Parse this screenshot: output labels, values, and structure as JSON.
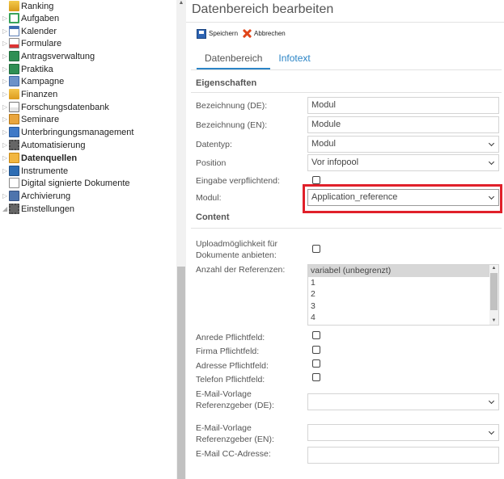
{
  "sidebar": {
    "items": [
      {
        "label": "Ranking",
        "icon": "trophy-icon",
        "expander": ""
      },
      {
        "label": "Aufgaben",
        "icon": "tasks-icon",
        "expander": "▷"
      },
      {
        "label": "Kalender",
        "icon": "calendar-icon",
        "expander": "▷"
      },
      {
        "label": "Formulare",
        "icon": "form-icon",
        "expander": "▷"
      },
      {
        "label": "Antragsverwaltung",
        "icon": "application-icon",
        "expander": "▷"
      },
      {
        "label": "Praktika",
        "icon": "internship-icon",
        "expander": "▷"
      },
      {
        "label": "Kampagne",
        "icon": "campaign-icon",
        "expander": "▷"
      },
      {
        "label": "Finanzen",
        "icon": "finance-icon",
        "expander": "▷"
      },
      {
        "label": "Forschungsdatenbank",
        "icon": "chart-icon",
        "expander": "▷"
      },
      {
        "label": "Seminare",
        "icon": "seminar-icon",
        "expander": "▷"
      },
      {
        "label": "Unterbringungsmanagement",
        "icon": "building-icon",
        "expander": "▷"
      },
      {
        "label": "Automatisierung",
        "icon": "gear-icon",
        "expander": "▷"
      },
      {
        "label": "Datenquellen",
        "icon": "database-icon",
        "expander": "▷"
      },
      {
        "label": "Instrumente",
        "icon": "instrument-icon",
        "expander": "▷"
      },
      {
        "label": "Digital signierte Dokumente",
        "icon": "document-icon",
        "expander": ""
      },
      {
        "label": "Archivierung",
        "icon": "archive-icon",
        "expander": "▷"
      },
      {
        "label": "Einstellungen",
        "icon": "settings-gear-icon",
        "expander": "◢"
      }
    ]
  },
  "main": {
    "title": "Datenbereich bearbeiten",
    "toolbar": {
      "save_label": "Speichern",
      "cancel_label": "Abbrechen"
    },
    "tabs": [
      {
        "label": "Datenbereich",
        "active": true
      },
      {
        "label": "Infotext",
        "active": false
      }
    ],
    "properties": {
      "heading": "Eigenschaften",
      "name_de": {
        "label": "Bezeichnung (DE):",
        "value": "Modul"
      },
      "name_en": {
        "label": "Bezeichnung (EN):",
        "value": "Module"
      },
      "datatype": {
        "label": "Datentyp:",
        "value": "Modul"
      },
      "position": {
        "label": "Position",
        "value": "Vor infopool"
      },
      "required": {
        "label": "Eingabe verpflichtend:",
        "checked": false
      },
      "module": {
        "label": "Modul:",
        "value": "Application_reference"
      }
    },
    "content": {
      "heading": "Content",
      "upload_label": "Uploadmöglichkeit für Dokumente anbieten:",
      "upload_checked": false,
      "ref_count_label": "Anzahl der Referenzen:",
      "ref_count_options": [
        "variabel (unbegrenzt)",
        "1",
        "2",
        "3",
        "4"
      ],
      "ref_count_selected": "variabel (unbegrenzt)",
      "salutation_label": "Anrede Pflichtfeld:",
      "company_label": "Firma Pflichtfeld:",
      "address_label": "Adresse Pflichtfeld:",
      "phone_label": "Telefon Pflichtfeld:",
      "email_tpl_de_label": "E-Mail-Vorlage Referenzgeber (DE):",
      "email_tpl_de_value": "",
      "email_tpl_en_label": "E-Mail-Vorlage Referenzgeber (EN):",
      "email_tpl_en_value": "",
      "email_cc_label": "E-Mail CC-Adresse:",
      "email_cc_value": ""
    }
  },
  "colors": {
    "accent": "#2a84c6",
    "highlight": "#e0202a"
  }
}
